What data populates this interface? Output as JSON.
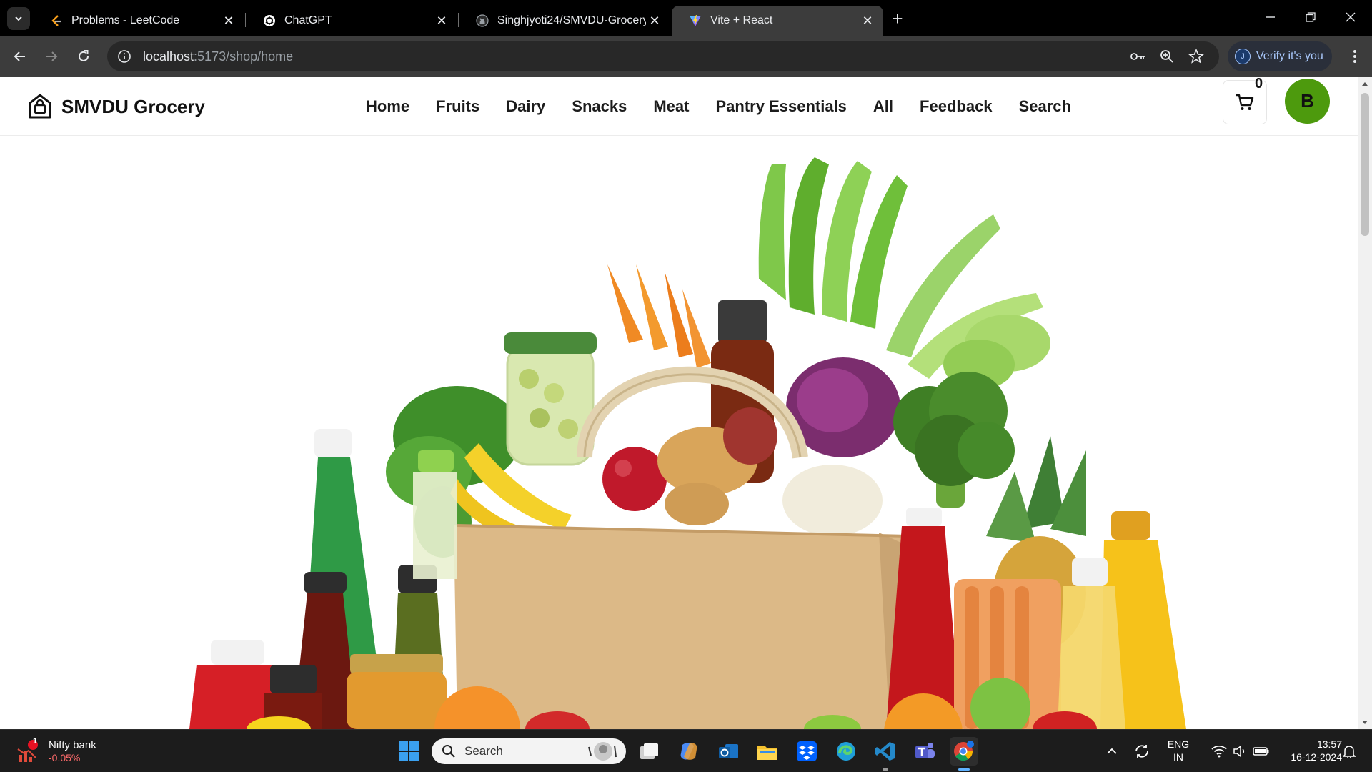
{
  "browser": {
    "tabs": [
      {
        "title": "Problems - LeetCode",
        "icon": "leetcode-icon"
      },
      {
        "title": "ChatGPT",
        "icon": "chatgpt-icon"
      },
      {
        "title": "Singhjyoti24/SMVDU-Grocery-/",
        "icon": "github-icon"
      },
      {
        "title": "Vite + React",
        "icon": "vite-icon",
        "active": true
      }
    ],
    "url_host": "localhost",
    "url_rest": ":5173/shop/home",
    "verify_label": "Verify it's you",
    "verify_avatar": "J"
  },
  "site": {
    "brand": "SMVDU Grocery",
    "nav": [
      "Home",
      "Fruits",
      "Dairy",
      "Snacks",
      "Meat",
      "Pantry Essentials",
      "All",
      "Feedback",
      "Search"
    ],
    "cart_count": "0",
    "user_initial": "B",
    "accent_color": "#4d9a0d"
  },
  "taskbar": {
    "widget_badge": "1",
    "widget_title": "Nifty bank",
    "widget_value": "-0.05%",
    "search_placeholder": "Search",
    "lang_line1": "ENG",
    "lang_line2": "IN",
    "time": "13:57",
    "date": "16-12-2024"
  }
}
